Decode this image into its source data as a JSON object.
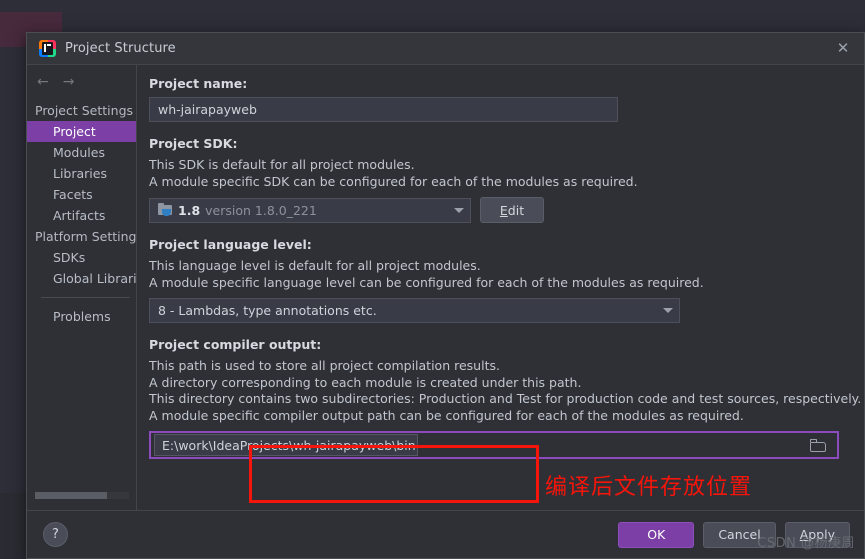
{
  "window": {
    "title": "Project Structure",
    "app_icon": "intellij-idea-icon",
    "close_label": "✕"
  },
  "nav": {
    "back_icon": "←",
    "forward_icon": "→"
  },
  "sidebar": {
    "groups": [
      {
        "label": "Project Settings",
        "type": "group"
      },
      {
        "label": "Project",
        "type": "item",
        "selected": true
      },
      {
        "label": "Modules",
        "type": "item",
        "selected": false
      },
      {
        "label": "Libraries",
        "type": "item",
        "selected": false
      },
      {
        "label": "Facets",
        "type": "item",
        "selected": false
      },
      {
        "label": "Artifacts",
        "type": "item",
        "selected": false
      },
      {
        "label": "Platform Settings",
        "type": "group"
      },
      {
        "label": "SDKs",
        "type": "item",
        "selected": false
      },
      {
        "label": "Global Libraries",
        "type": "item",
        "selected": false
      },
      {
        "label": "Problems",
        "type": "item",
        "selected": false
      }
    ]
  },
  "main": {
    "project_name": {
      "label": "Project name:",
      "value": "wh-jairapayweb"
    },
    "project_sdk": {
      "label": "Project SDK:",
      "desc_line1": "This SDK is default for all project modules.",
      "desc_line2": "A module specific SDK can be configured for each of the modules as required.",
      "selected_version": "1.8",
      "selected_detail": "version 1.8.0_221",
      "sdk_icon": "java-sdk-icon",
      "edit_button": "Edit",
      "edit_mnemonic": "E",
      "edit_rest": "dit"
    },
    "language_level": {
      "label": "Project language level:",
      "desc_line1": "This language level is default for all project modules.",
      "desc_line2": "A module specific language level can be configured for each of the modules as required.",
      "selected": "8 - Lambdas, type annotations etc."
    },
    "compiler_output": {
      "label": "Project compiler output:",
      "desc_line1": "This path is used to store all project compilation results.",
      "desc_line2": "A directory corresponding to each module is created under this path.",
      "desc_line3": "This directory contains two subdirectories: Production and Test for production code and test sources, respectively.",
      "desc_line4": "A module specific compiler output path can be configured for each of the modules as required.",
      "path_value": "E:\\work\\IdeaProjects\\wh-jairapayweb\\bin",
      "browse_icon": "folder-browse-icon"
    }
  },
  "annotations": {
    "highlight_color": "#f5150a",
    "note_text": "编译后文件存放位置"
  },
  "footer": {
    "help_label": "?",
    "ok_label": "OK",
    "cancel_label": "Cancel",
    "apply_mnemonic": "A",
    "apply_rest": "pply"
  },
  "watermark": {
    "text": "CSDN @杨庚周"
  },
  "colors": {
    "accent_purple": "#7c3fa6",
    "focus_purple": "#8c4bbd",
    "annotation_red": "#f5150a",
    "dialog_bg": "#2e3036",
    "titlebar_bg": "#35363c"
  }
}
